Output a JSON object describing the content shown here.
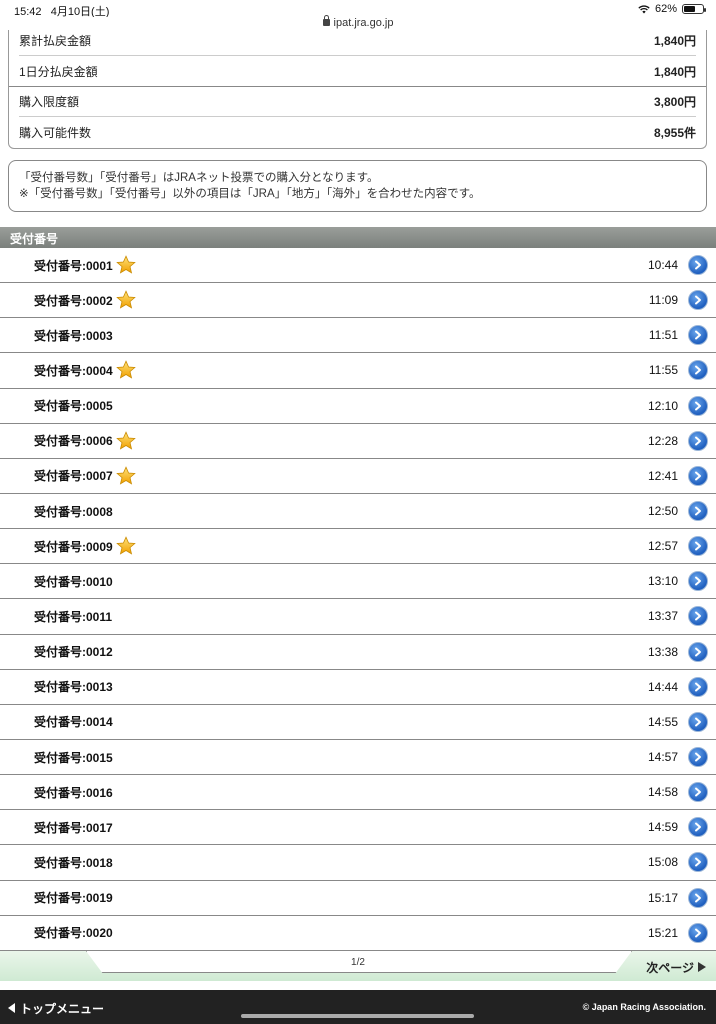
{
  "status": {
    "time": "15:42",
    "date": "4月10日(土)",
    "battery": "62%",
    "battery_level": 0.62
  },
  "browser": {
    "url": "ipat.jra.go.jp"
  },
  "summary": {
    "rows": [
      {
        "label": "累計払戻金額",
        "value": "1,840円"
      },
      {
        "label": "1日分払戻金額",
        "value": "1,840円"
      },
      {
        "label": "購入限度額",
        "value": "3,800円"
      },
      {
        "label": "購入可能件数",
        "value": "8,955件"
      }
    ]
  },
  "notes": {
    "line1": "「受付番号数」「受付番号」はJRAネット投票での購入分となります。",
    "line2": "※「受付番号数」「受付番号」以外の項目は「JRA」「地方」「海外」を合わせた内容です。"
  },
  "section": {
    "title": "受付番号"
  },
  "receipts": [
    {
      "label": "受付番号:0001",
      "time": "10:44",
      "starred": true
    },
    {
      "label": "受付番号:0002",
      "time": "11:09",
      "starred": true
    },
    {
      "label": "受付番号:0003",
      "time": "11:51",
      "starred": false
    },
    {
      "label": "受付番号:0004",
      "time": "11:55",
      "starred": true
    },
    {
      "label": "受付番号:0005",
      "time": "12:10",
      "starred": false
    },
    {
      "label": "受付番号:0006",
      "time": "12:28",
      "starred": true
    },
    {
      "label": "受付番号:0007",
      "time": "12:41",
      "starred": true
    },
    {
      "label": "受付番号:0008",
      "time": "12:50",
      "starred": false
    },
    {
      "label": "受付番号:0009",
      "time": "12:57",
      "starred": true
    },
    {
      "label": "受付番号:0010",
      "time": "13:10",
      "starred": false
    },
    {
      "label": "受付番号:0011",
      "time": "13:37",
      "starred": false
    },
    {
      "label": "受付番号:0012",
      "time": "13:38",
      "starred": false
    },
    {
      "label": "受付番号:0013",
      "time": "14:44",
      "starred": false
    },
    {
      "label": "受付番号:0014",
      "time": "14:55",
      "starred": false
    },
    {
      "label": "受付番号:0015",
      "time": "14:57",
      "starred": false
    },
    {
      "label": "受付番号:0016",
      "time": "14:58",
      "starred": false
    },
    {
      "label": "受付番号:0017",
      "time": "14:59",
      "starred": false
    },
    {
      "label": "受付番号:0018",
      "time": "15:08",
      "starred": false
    },
    {
      "label": "受付番号:0019",
      "time": "15:17",
      "starred": false
    },
    {
      "label": "受付番号:0020",
      "time": "15:21",
      "starred": false
    }
  ],
  "pager": {
    "page": "1/2",
    "next_label": "次ページ"
  },
  "footer": {
    "top_menu": "トップメニュー",
    "copyright": "© Japan Racing Association."
  },
  "colors": {
    "header_bg": "#7b807c",
    "link_blue": "#1f5fbf",
    "star": "#f5b400",
    "pager_bg": "#cfead3",
    "footer_bg": "#222222"
  },
  "icons": {
    "star": "star-icon",
    "detail": "chevron-right-circle-icon",
    "wifi": "wifi-icon",
    "battery": "battery-icon",
    "lock": "lock-icon"
  }
}
